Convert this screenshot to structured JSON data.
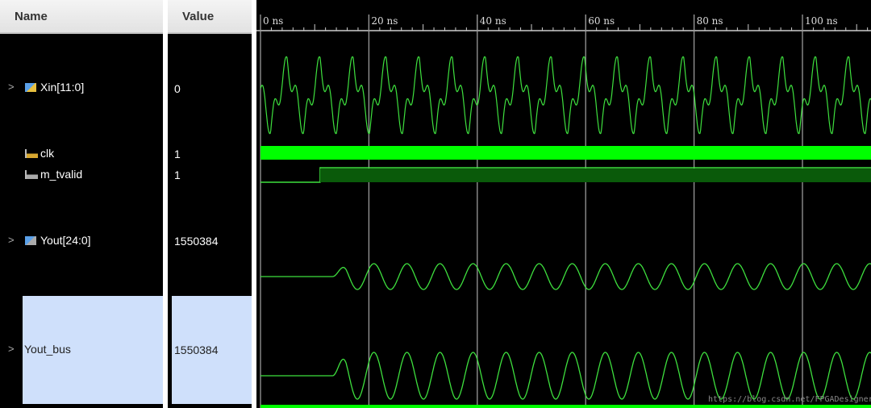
{
  "columns": {
    "name": "Name",
    "value": "Value"
  },
  "signals": [
    {
      "name": "Xin[11:0]",
      "value": "0",
      "type": "bus",
      "expandable": true
    },
    {
      "name": "clk",
      "value": "1",
      "type": "bit"
    },
    {
      "name": "m_tvalid",
      "value": "1",
      "type": "bit"
    },
    {
      "name": "Yout[24:0]",
      "value": "1550384",
      "type": "bus",
      "expandable": true
    },
    {
      "name": "Yout_bus",
      "value": "1550384",
      "type": "bus",
      "expandable": true,
      "selected": true
    }
  ],
  "timeline": {
    "unit": "ns",
    "labels": [
      "0 ns",
      "20 ns",
      "40 ns",
      "60 ns",
      "80 ns",
      "100 ns"
    ],
    "major_step_ns": 20,
    "visible_range_ns": [
      0,
      112.5
    ]
  },
  "waveforms": {
    "m_tvalid_rise_ns": 11,
    "yout_start_ns": 13.3,
    "period_ns": 6.1
  },
  "colors": {
    "wave": "#3ee03e",
    "clk": "#00ff00",
    "valid_fill": "#0a5a0a",
    "grid": "#9a9a9a",
    "selected": "#cfe0fb"
  },
  "watermark": "https://blog.csdn.net/FPGADesigner"
}
